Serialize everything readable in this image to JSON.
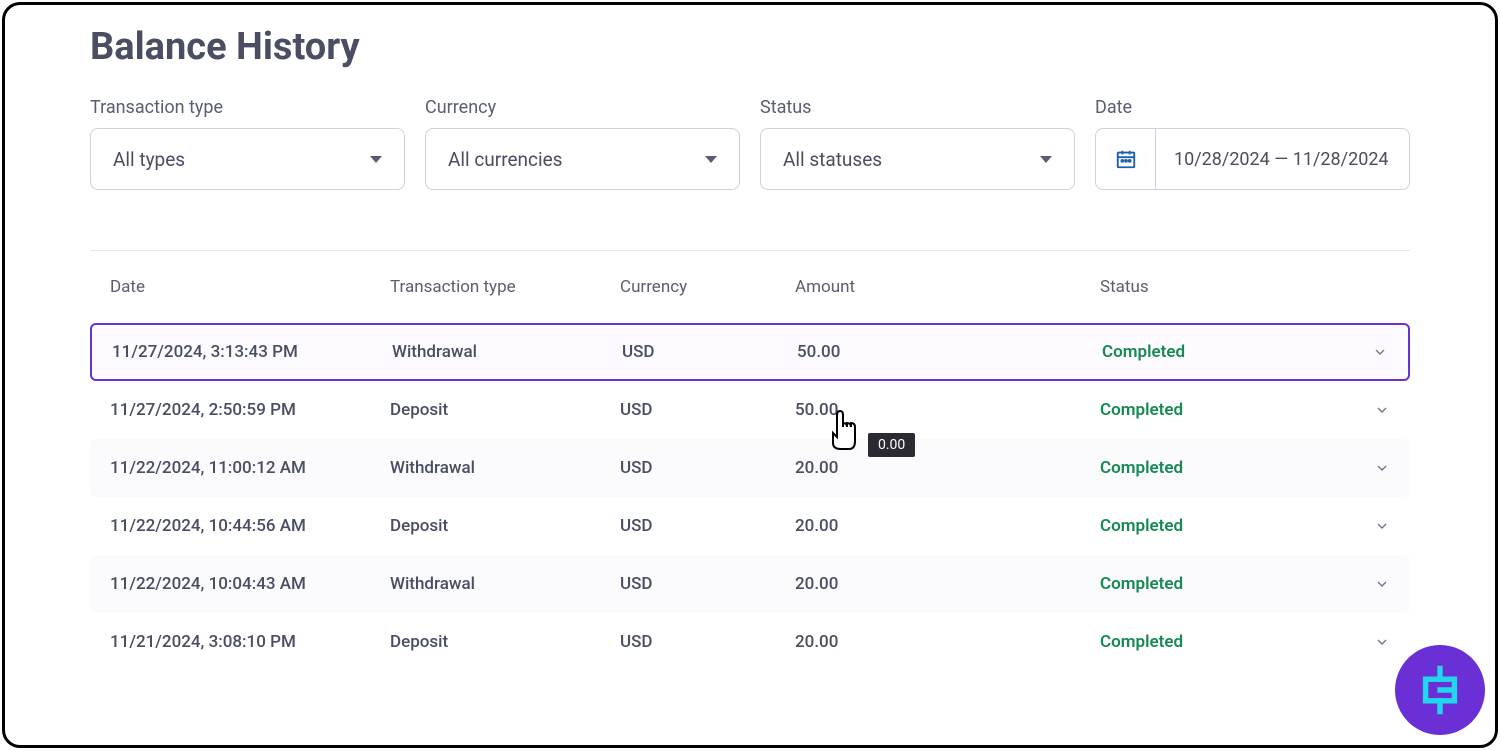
{
  "title": "Balance History",
  "filters": {
    "transaction_type": {
      "label": "Transaction type",
      "value": "All types"
    },
    "currency": {
      "label": "Currency",
      "value": "All currencies"
    },
    "status": {
      "label": "Status",
      "value": "All statuses"
    },
    "date": {
      "label": "Date",
      "range": "10/28/2024 — 11/28/2024"
    }
  },
  "table": {
    "columns": {
      "date": "Date",
      "type": "Transaction type",
      "currency": "Currency",
      "amount": "Amount",
      "status": "Status"
    },
    "rows": [
      {
        "date": "11/27/2024, 3:13:43 PM",
        "type": "Withdrawal",
        "currency": "USD",
        "amount": "50.00",
        "status": "Completed"
      },
      {
        "date": "11/27/2024, 2:50:59 PM",
        "type": "Deposit",
        "currency": "USD",
        "amount": "50.00",
        "status": "Completed"
      },
      {
        "date": "11/22/2024, 11:00:12 AM",
        "type": "Withdrawal",
        "currency": "USD",
        "amount": "20.00",
        "status": "Completed"
      },
      {
        "date": "11/22/2024, 10:44:56 AM",
        "type": "Deposit",
        "currency": "USD",
        "amount": "20.00",
        "status": "Completed"
      },
      {
        "date": "11/22/2024, 10:04:43 AM",
        "type": "Withdrawal",
        "currency": "USD",
        "amount": "20.00",
        "status": "Completed"
      },
      {
        "date": "11/21/2024, 3:08:10 PM",
        "type": "Deposit",
        "currency": "USD",
        "amount": "20.00",
        "status": "Completed"
      }
    ]
  },
  "tooltip_text": "0.00"
}
